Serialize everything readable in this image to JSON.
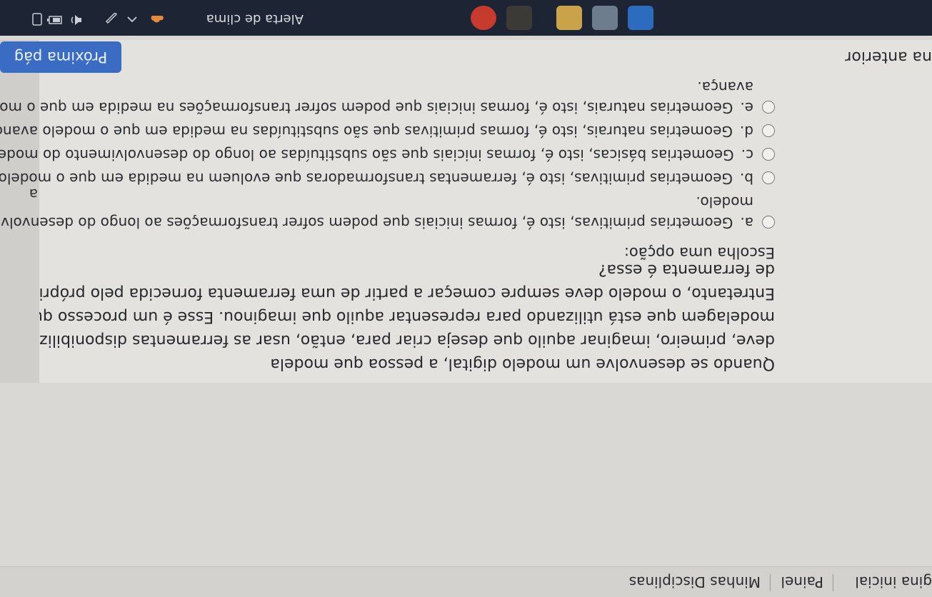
{
  "nav": {
    "items": [
      "gina inicial",
      "Painel",
      "Minhas Disciplinas"
    ]
  },
  "question": {
    "stem_lines": [
      "Quando se desenvolve um modelo digital, a pessoa que modela",
      "deve, primeiro, imaginar aquilo que deseja criar para, então, usar as ferramentas disponibilizadas pelo software de",
      "modelagem que está utilizando para representar aquilo que imaginou. Esse é um processo que se retroalimenta.",
      "Entretanto, o modelo deve sempre começar a partir de uma ferramenta fornecida pelo próprio software. Que tipo",
      "de ferramenta é essa?"
    ],
    "prompt": "Escolha uma opção:",
    "options": [
      {
        "letter": "a.",
        "text": "Geometrias primitivas, isto é, formas iniciais que podem sofrer transformações ao longo do desenvolvimento do",
        "cont": "modelo."
      },
      {
        "letter": "b.",
        "text": "Geometrias primitivas, isto é, ferramentas transformadoras que evoluem na medida em que o modelo avança",
        "cont": ""
      },
      {
        "letter": "c.",
        "text": "Geometrias básicas, isto é, formas iniciais que são substituídas ao longo do desenvolvimento do modelo.",
        "cont": ""
      },
      {
        "letter": "d.",
        "text": "Geometrias naturais, isto é, formas primitivas que são substituídas na medida em que o modelo avança.",
        "cont": ""
      },
      {
        "letter": "e.",
        "text": "Geometrias naturais, isto é, formas iniciais que podem sofrer transformações na medida em que o modelo",
        "cont": "avança."
      }
    ]
  },
  "footer": {
    "prev_label": "na anterior",
    "next_label": "Próxima pág",
    "side_mark": "a"
  },
  "taskbar": {
    "weather_label": "Alerta de clima",
    "icons": [
      "weather-alert-icon",
      "chevron-up-icon",
      "pen-icon",
      "network-icon",
      "battery-icon",
      "volume-icon"
    ]
  },
  "colors": {
    "accent": "#3a6cc4",
    "taskbar": "#1d2433"
  }
}
